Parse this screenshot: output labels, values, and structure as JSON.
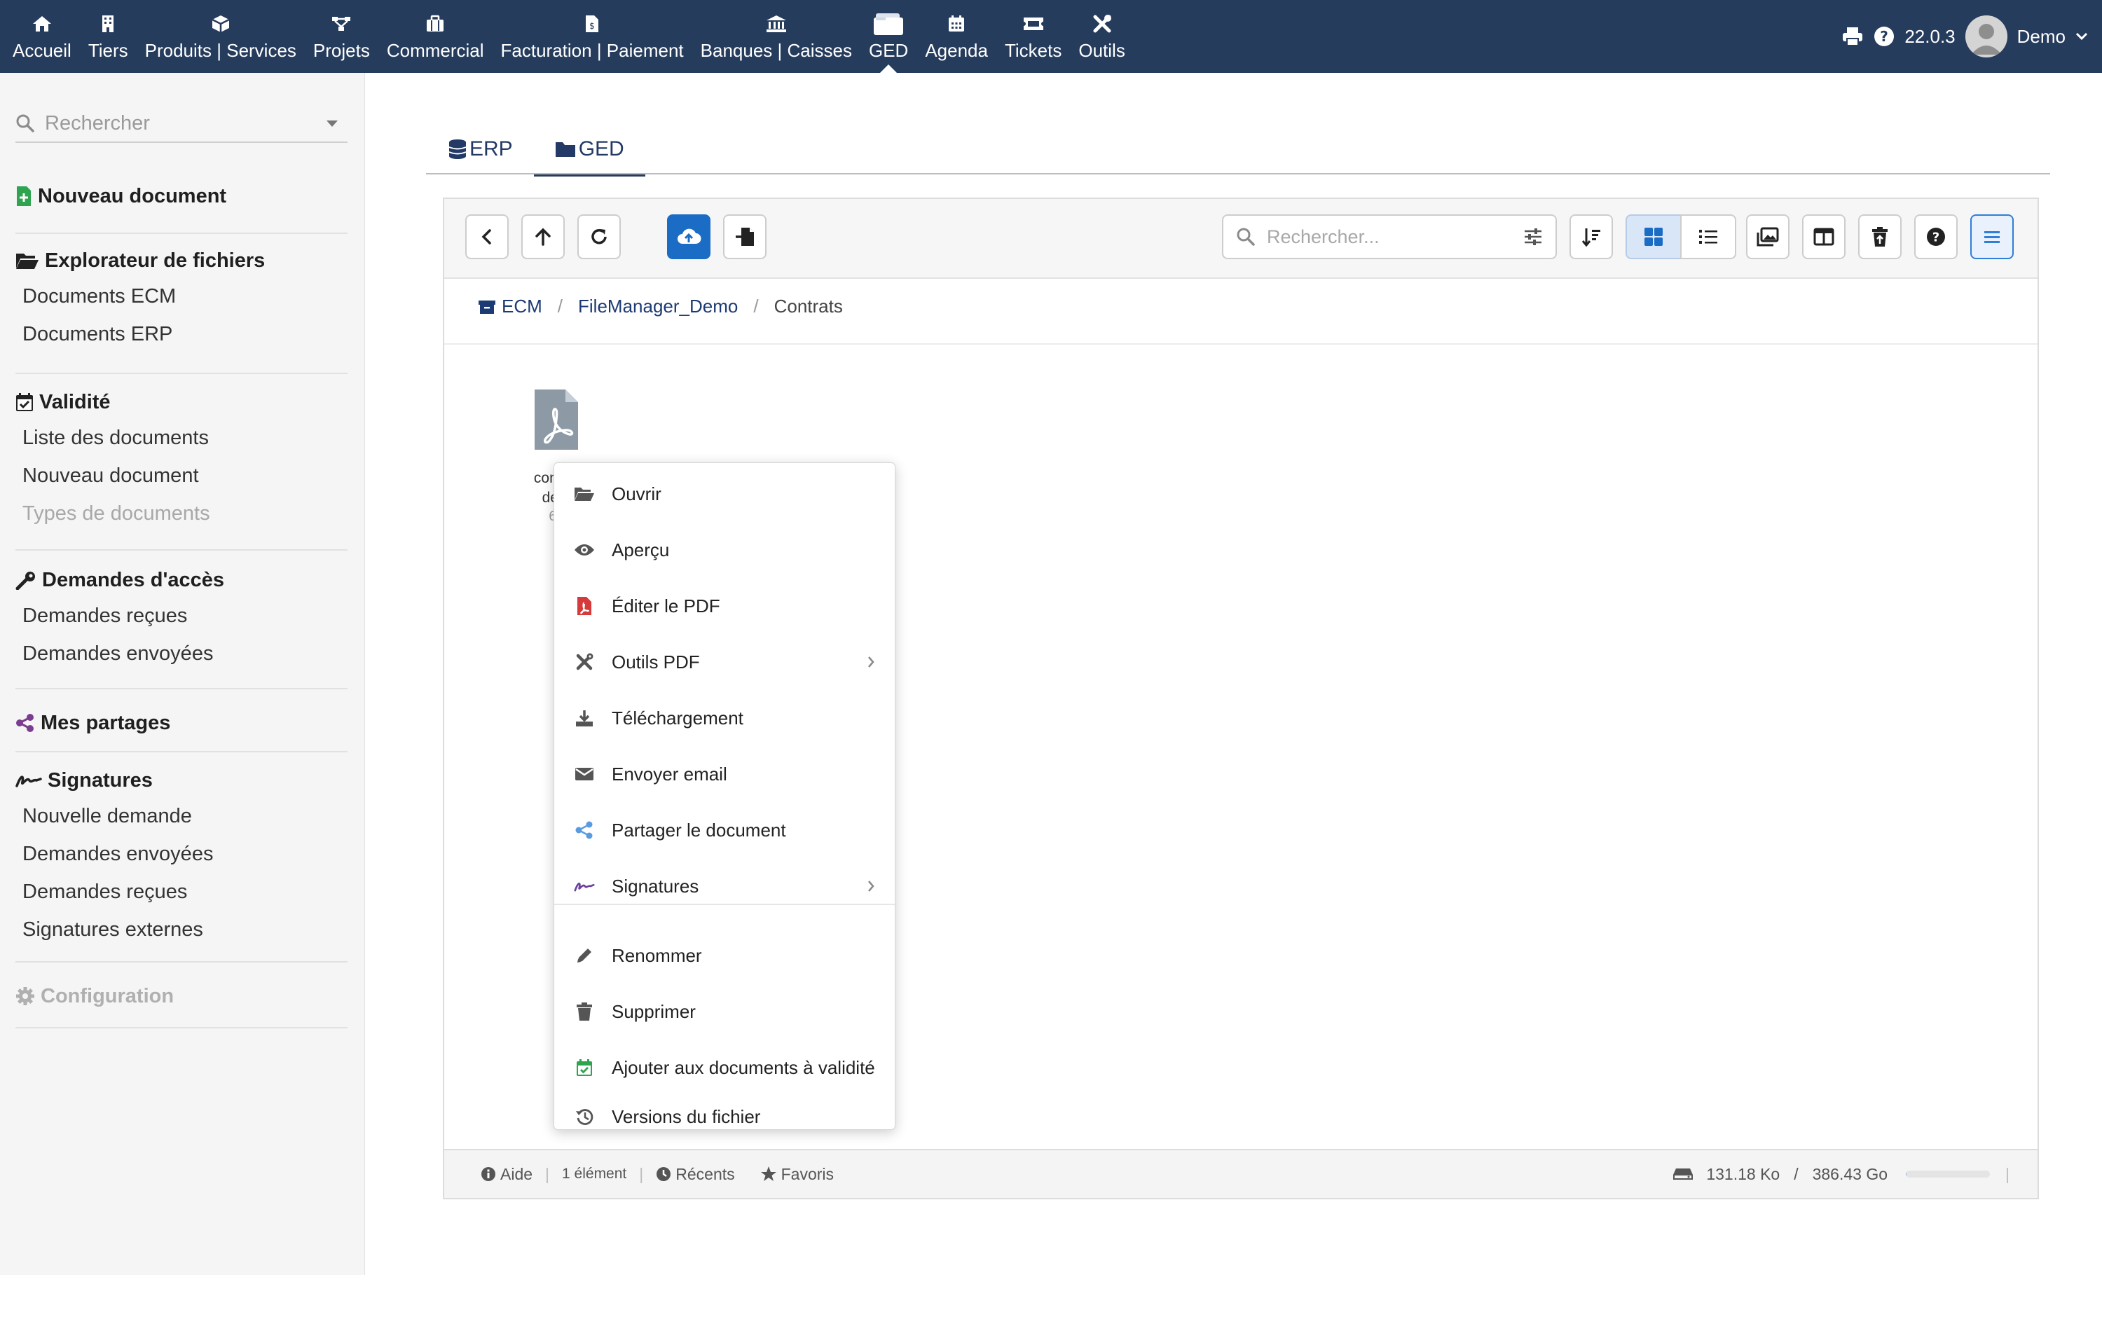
{
  "topnav": {
    "items": [
      {
        "label": "Accueil",
        "icon": "home-icon"
      },
      {
        "label": "Tiers",
        "icon": "building-icon"
      },
      {
        "label": "Produits | Services",
        "icon": "cube-icon"
      },
      {
        "label": "Projets",
        "icon": "sitemap-icon"
      },
      {
        "label": "Commercial",
        "icon": "suitcase-icon"
      },
      {
        "label": "Facturation | Paiement",
        "icon": "invoice-icon"
      },
      {
        "label": "Banques | Caisses",
        "icon": "bank-icon"
      },
      {
        "label": "GED",
        "icon": "folder-stack-icon"
      },
      {
        "label": "Agenda",
        "icon": "calendar-icon"
      },
      {
        "label": "Tickets",
        "icon": "ticket-icon"
      },
      {
        "label": "Outils",
        "icon": "tools-icon"
      }
    ],
    "active": "GED",
    "version": "22.0.3",
    "user": "Demo"
  },
  "sidebar": {
    "search_placeholder": "Rechercher",
    "new_document": "Nouveau document",
    "explorer": {
      "title": "Explorateur de fichiers",
      "links": [
        "Documents ECM",
        "Documents ERP"
      ]
    },
    "validity": {
      "title": "Validité",
      "links": [
        "Liste des documents",
        "Nouveau document",
        "Types de documents"
      ]
    },
    "access": {
      "title": "Demandes d'accès",
      "links": [
        "Demandes reçues",
        "Demandes envoyées"
      ]
    },
    "shares": {
      "title": "Mes partages"
    },
    "signatures": {
      "title": "Signatures",
      "links": [
        "Nouvelle demande",
        "Demandes envoyées",
        "Demandes reçues",
        "Signatures externes"
      ]
    },
    "configuration": {
      "title": "Configuration"
    }
  },
  "tabs": [
    {
      "label": "ERP",
      "icon": "database-icon"
    },
    {
      "label": "GED",
      "icon": "folder-icon"
    }
  ],
  "active_tab": "GED",
  "filemanager": {
    "search_placeholder": "Rechercher...",
    "breadcrumb": [
      "ECM",
      "FileManager_Demo",
      "Contrats"
    ],
    "file": {
      "name_line1": "contrat",
      "name_line2": "dem",
      "size": "66"
    },
    "status": {
      "help": "Aide",
      "count": "1 élément",
      "recent": "Récents",
      "favorites": "Favoris",
      "used": "131.18 Ko",
      "separator": "/",
      "total": "386.43 Go",
      "usage_fraction": 0.0003
    }
  },
  "context_menu": {
    "items": [
      {
        "label": "Ouvrir",
        "icon": "folder-open-icon"
      },
      {
        "label": "Aperçu",
        "icon": "eye-icon"
      },
      {
        "label": "Éditer le PDF",
        "icon": "pdf-icon"
      },
      {
        "label": "Outils PDF",
        "icon": "tools-icon",
        "submenu": true
      },
      {
        "label": "Téléchargement",
        "icon": "download-icon"
      },
      {
        "label": "Envoyer email",
        "icon": "envelope-icon"
      },
      {
        "label": "Partager le document",
        "icon": "share-icon"
      },
      {
        "label": "Signatures",
        "icon": "signature-icon",
        "submenu": true
      },
      {
        "label": "Renommer",
        "icon": "pencil-icon"
      },
      {
        "label": "Supprimer",
        "icon": "trash-icon"
      },
      {
        "label": "Ajouter aux documents à validité",
        "icon": "calendar-check-icon"
      },
      {
        "label": "Versions du fichier",
        "icon": "history-icon"
      }
    ]
  },
  "colors": {
    "topbar": "#263c5c",
    "primary_button": "#1a6cc5",
    "link": "#1c3a73",
    "new_doc_icon": "#2ea44f",
    "pdf_red": "#d73a3a",
    "share_blue": "#5a9be0",
    "signature_purple": "#6b3fa0",
    "shares_purple": "#7a3d8f"
  }
}
